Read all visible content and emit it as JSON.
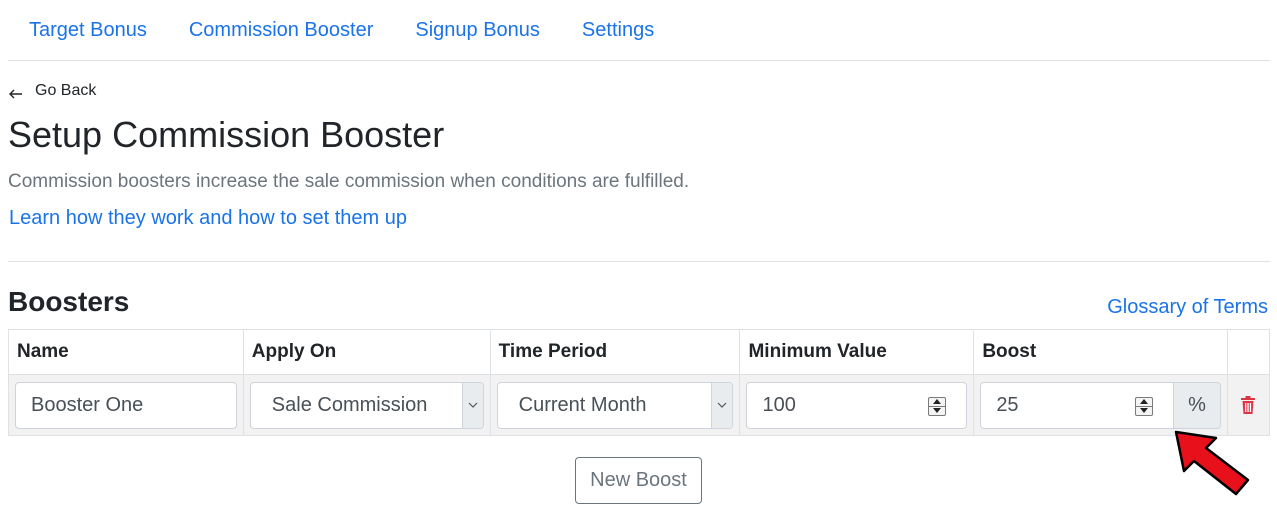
{
  "tabs": [
    {
      "label": "Target Bonus"
    },
    {
      "label": "Commission Booster"
    },
    {
      "label": "Signup Bonus"
    },
    {
      "label": "Settings"
    }
  ],
  "nav": {
    "back_label": "Go Back"
  },
  "header": {
    "title": "Setup Commission Booster",
    "subtitle": "Commission boosters increase the sale commission when conditions are fulfilled.",
    "learn_link": "Learn how they work and how to set them up"
  },
  "boosters": {
    "title": "Boosters",
    "glossary_link": "Glossary of Terms",
    "columns": [
      "Name",
      "Apply On",
      "Time Period",
      "Minimum Value",
      "Boost"
    ],
    "rows": [
      {
        "name": "Booster One",
        "apply_on": "Sale Commission",
        "time_period": "Current Month",
        "minimum_value": "100",
        "boost": "25",
        "boost_unit": "%"
      }
    ],
    "new_boost_label": "New Boost"
  },
  "colors": {
    "link": "#1a73e8",
    "danger": "#dc3545",
    "annotation_arrow": "#e8101a"
  }
}
